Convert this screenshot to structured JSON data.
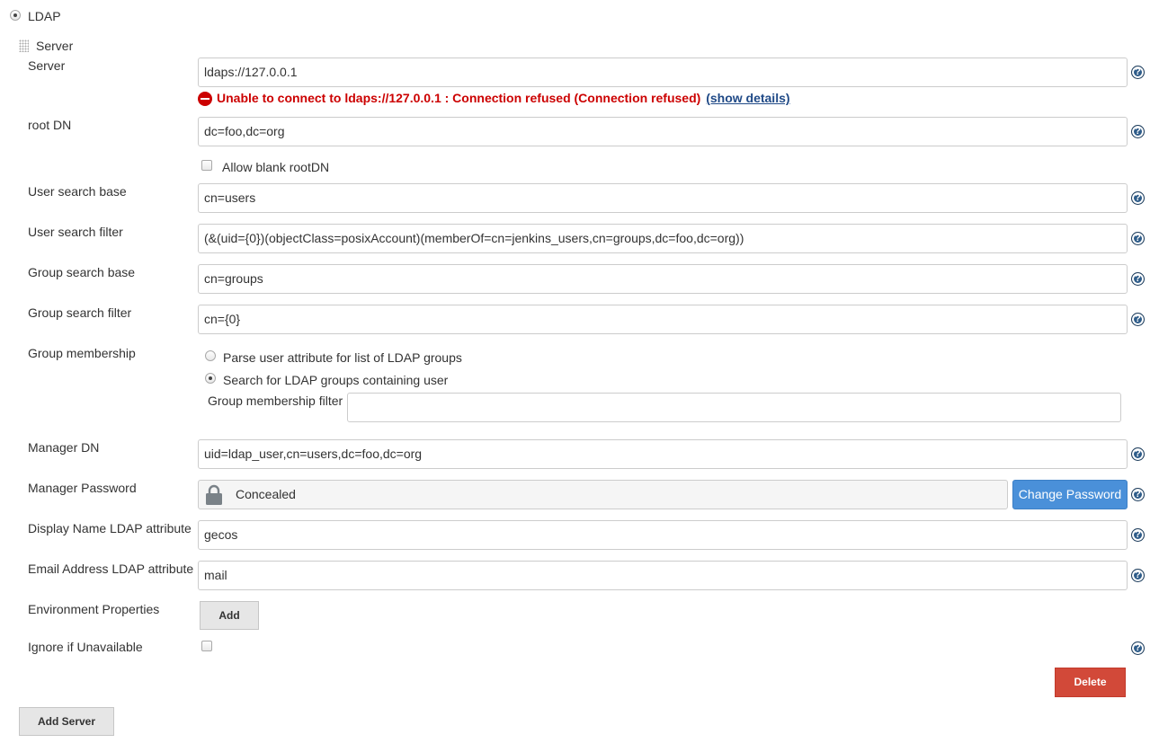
{
  "realm": {
    "label": "LDAP",
    "selected": true
  },
  "server_header": {
    "label": "Server"
  },
  "fields": {
    "server": {
      "label": "Server",
      "value": "ldaps://127.0.0.1"
    },
    "error": {
      "message": "Unable to connect to ldaps://127.0.0.1 : Connection refused (Connection refused)",
      "details_link": "(show details)"
    },
    "root_dn": {
      "label": "root DN",
      "value": "dc=foo,dc=org"
    },
    "allow_blank_root_dn": {
      "label": "Allow blank rootDN",
      "checked": false
    },
    "user_search_base": {
      "label": "User search base",
      "value": "cn=users"
    },
    "user_search_filter": {
      "label": "User search filter",
      "value": "(&(uid={0})(objectClass=posixAccount)(memberOf=cn=jenkins_users,cn=groups,dc=foo,dc=org))"
    },
    "group_search_base": {
      "label": "Group search base",
      "value": "cn=groups"
    },
    "group_search_filter": {
      "label": "Group search filter",
      "value": "cn={0}"
    },
    "group_membership": {
      "label": "Group membership",
      "option_parse": "Parse user attribute for list of LDAP groups",
      "option_search": "Search for LDAP groups containing user",
      "selected": "search",
      "filter_label": "Group membership filter",
      "filter_value": ""
    },
    "manager_dn": {
      "label": "Manager DN",
      "value": "uid=ldap_user,cn=users,dc=foo,dc=org"
    },
    "manager_password": {
      "label": "Manager Password",
      "value": "Concealed",
      "change_button": "Change Password"
    },
    "display_name_attr": {
      "label": "Display Name LDAP attribute",
      "value": "gecos"
    },
    "email_attr": {
      "label": "Email Address LDAP attribute",
      "value": "mail"
    },
    "environment_properties": {
      "label": "Environment Properties",
      "add_button": "Add"
    },
    "ignore_if_unavailable": {
      "label": "Ignore if Unavailable",
      "checked": false
    }
  },
  "help_icon_glyph": "?",
  "buttons": {
    "delete": "Delete",
    "add_server": "Add Server"
  },
  "colors": {
    "error_red": "#cc0000",
    "link_blue": "#204a87",
    "primary_blue": "#4a90d9",
    "danger_red": "#d24939",
    "help_blue": "#2f5d8a"
  }
}
